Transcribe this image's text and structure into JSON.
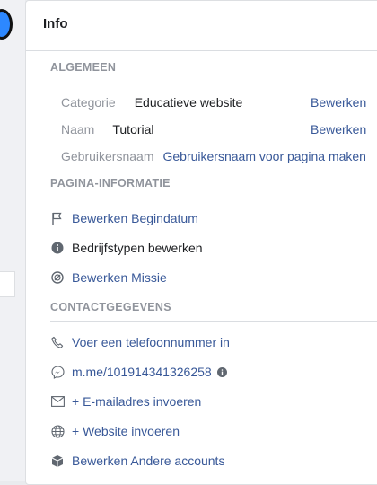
{
  "panel": {
    "title": "Info"
  },
  "general": {
    "heading": "ALGEMEEN",
    "category": {
      "label": "Categorie",
      "value": "Educatieve website",
      "edit": "Bewerken"
    },
    "name": {
      "label": "Naam",
      "value": "Tutorial",
      "edit": "Bewerken"
    },
    "username": {
      "label": "Gebruikersnaam",
      "link": "Gebruikersnaam voor pagina maken"
    }
  },
  "page_info": {
    "heading": "PAGINA-INFORMATIE",
    "items": [
      {
        "label": "Bewerken Begindatum",
        "icon": "flag-icon"
      },
      {
        "label": "Bedrijfstypen bewerken",
        "icon": "info-circle-icon"
      },
      {
        "label": "Bewerken Missie",
        "icon": "mission-icon"
      }
    ]
  },
  "contact": {
    "heading": "CONTACTGEGEVENS",
    "items": [
      {
        "label": "Voer een telefoonnummer in",
        "icon": "phone-icon"
      },
      {
        "label": "m.me/101914341326258",
        "icon": "messenger-icon"
      },
      {
        "label": "+ E-mailadres invoeren",
        "icon": "envelope-icon"
      },
      {
        "label": "+ Website invoeren",
        "icon": "globe-icon"
      },
      {
        "label": "Bewerken Andere accounts",
        "icon": "cube-icon"
      }
    ]
  },
  "colors": {
    "link": "#385898",
    "heading": "#90949c",
    "text": "#1c1e21"
  }
}
